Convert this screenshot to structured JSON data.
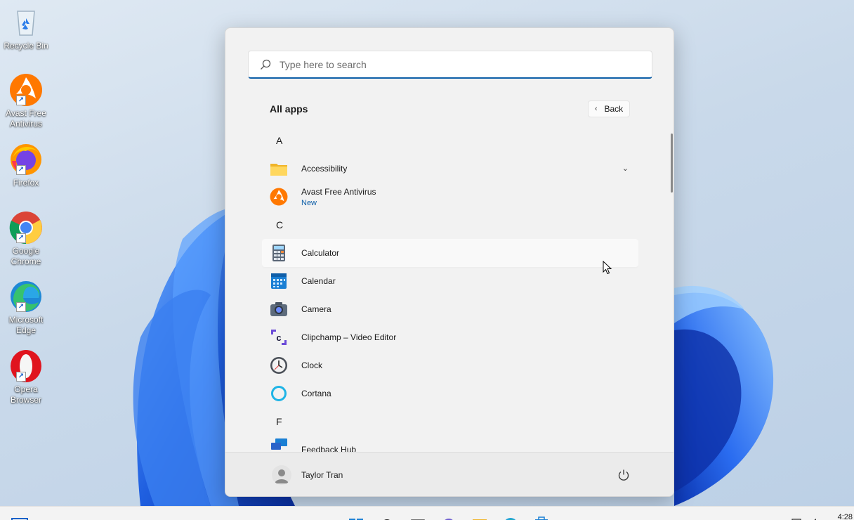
{
  "desktop": {
    "icons": [
      {
        "label": "Recycle Bin",
        "icon": "recycle-bin-icon"
      },
      {
        "label": "Avast Free Antivirus",
        "icon": "avast-icon"
      },
      {
        "label": "Firefox",
        "icon": "firefox-icon"
      },
      {
        "label": "Google Chrome",
        "icon": "chrome-icon"
      },
      {
        "label": "Microsoft Edge",
        "icon": "edge-icon"
      },
      {
        "label": "Opera Browser",
        "icon": "opera-icon"
      }
    ]
  },
  "start_menu": {
    "search": {
      "placeholder": "Type here to search"
    },
    "title": "All apps",
    "back_label": "Back",
    "groups": [
      {
        "letter": "A",
        "apps": [
          {
            "name": "Accessibility",
            "icon": "folder-icon",
            "expandable": true
          },
          {
            "name": "Avast Free Antivirus",
            "subtitle": "New",
            "icon": "avast-icon"
          }
        ]
      },
      {
        "letter": "C",
        "apps": [
          {
            "name": "Calculator",
            "icon": "calculator-icon"
          },
          {
            "name": "Calendar",
            "icon": "calendar-icon"
          },
          {
            "name": "Camera",
            "icon": "camera-icon"
          },
          {
            "name": "Clipchamp – Video Editor",
            "icon": "clipchamp-icon"
          },
          {
            "name": "Clock",
            "icon": "clock-icon"
          },
          {
            "name": "Cortana",
            "icon": "cortana-icon"
          }
        ]
      },
      {
        "letter": "F",
        "apps": [
          {
            "name": "Feedback Hub",
            "icon": "feedback-hub-icon"
          }
        ]
      }
    ],
    "user": {
      "name": "Taylor Tran"
    }
  },
  "taskbar": {
    "time": "4:28",
    "icons": [
      "start-icon",
      "search-icon",
      "task-view-icon",
      "chat-icon",
      "file-explorer-icon",
      "edge-icon",
      "store-icon"
    ]
  },
  "colors": {
    "accent": "#0e5fa8",
    "menu_bg": "#f2f2f2",
    "bloom_blue": "#1f5fe0"
  }
}
